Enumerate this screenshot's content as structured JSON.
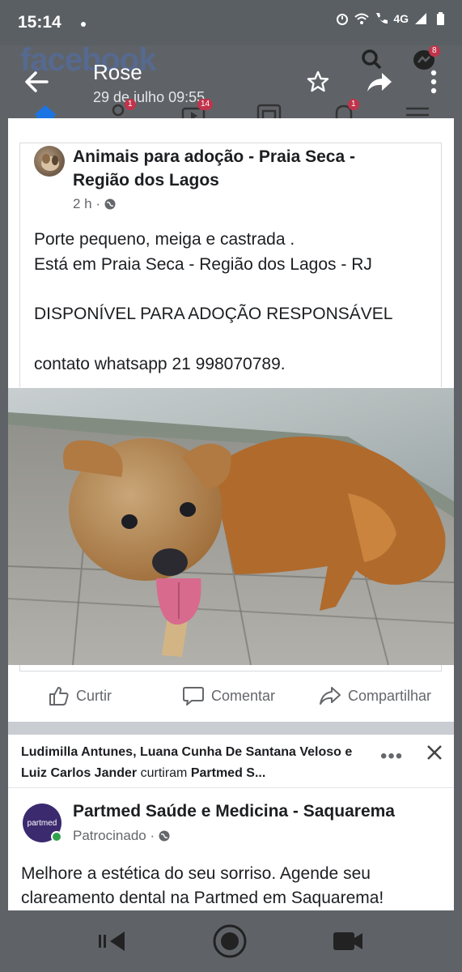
{
  "status_bar": {
    "time": "15:14",
    "network": "4G"
  },
  "viewer": {
    "title": "Rose",
    "subtitle": "29 de julho 09:55"
  },
  "fb": {
    "logo": "facebook",
    "tabs": [
      {
        "icon": "home-icon",
        "badge": ""
      },
      {
        "icon": "friends-icon",
        "badge": "1"
      },
      {
        "icon": "watch-icon",
        "badge": "14"
      },
      {
        "icon": "marketplace-icon",
        "badge": ""
      },
      {
        "icon": "bell-icon",
        "badge": "1"
      },
      {
        "icon": "menu-icon",
        "badge": ""
      }
    ],
    "messenger_badge": "8"
  },
  "post": {
    "group_name": "Animais para adoção - Praia Seca - Região dos Lagos",
    "time": "2 h ·",
    "lines": [
      "Porte pequeno, meiga e castrada .",
      "Está em Praia Seca - Região dos Lagos - RJ",
      "DISPONÍVEL PARA ADOÇÃO RESPONSÁVEL",
      "contato whatsapp 21 998070789."
    ],
    "actions": {
      "like": "Curtir",
      "comment": "Comentar",
      "share": "Compartilhar"
    }
  },
  "ad": {
    "liked_by_prefix": "Ludimilla Antunes, Luana Cunha De Santana Veloso e Luiz Carlos Jander",
    "liked_by_verb": " curtiram ",
    "liked_by_page": "Partmed S...",
    "avatar_text": "partmed",
    "name": "Partmed Saúde e Medicina - Saquarema",
    "sponsored": "Patrocinado ·",
    "text": "Melhore a estética do seu sorriso. Agende seu clareamento dental na Partmed em Saquarema!"
  },
  "colors": {
    "accent": "#1b74e4",
    "badge": "#c0344b",
    "overlay": "#5f6368"
  }
}
